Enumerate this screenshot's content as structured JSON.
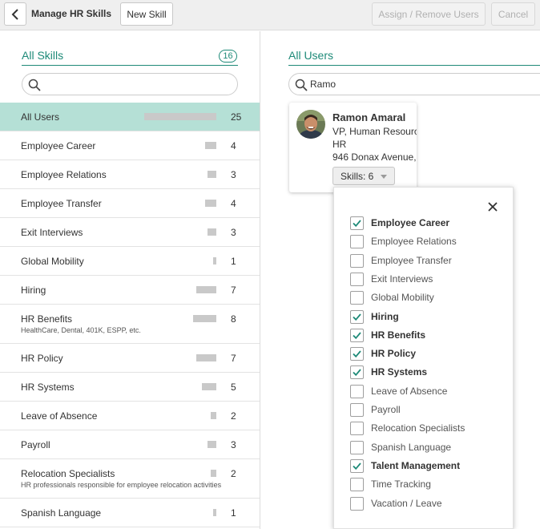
{
  "header": {
    "title": "Manage HR Skills",
    "new_skill_label": "New Skill",
    "assign_label": "Assign / Remove Users",
    "cancel_label": "Cancel"
  },
  "left": {
    "title": "All Skills",
    "count": "16",
    "search_value": "",
    "skills": [
      {
        "name": "All Users",
        "sub": "",
        "count": "25",
        "bar": 1.0,
        "selected": true
      },
      {
        "name": "Employee Career",
        "sub": "",
        "count": "4",
        "bar": 0.16
      },
      {
        "name": "Employee Relations",
        "sub": "",
        "count": "3",
        "bar": 0.12
      },
      {
        "name": "Employee Transfer",
        "sub": "",
        "count": "4",
        "bar": 0.16
      },
      {
        "name": "Exit Interviews",
        "sub": "",
        "count": "3",
        "bar": 0.12
      },
      {
        "name": "Global Mobility",
        "sub": "",
        "count": "1",
        "bar": 0.04
      },
      {
        "name": "Hiring",
        "sub": "",
        "count": "7",
        "bar": 0.28
      },
      {
        "name": "HR Benefits",
        "sub": "HealthCare, Dental, 401K, ESPP, etc.",
        "count": "8",
        "bar": 0.32
      },
      {
        "name": "HR Policy",
        "sub": "",
        "count": "7",
        "bar": 0.28
      },
      {
        "name": "HR Systems",
        "sub": "",
        "count": "5",
        "bar": 0.2
      },
      {
        "name": "Leave of Absence",
        "sub": "",
        "count": "2",
        "bar": 0.08
      },
      {
        "name": "Payroll",
        "sub": "",
        "count": "3",
        "bar": 0.12
      },
      {
        "name": "Relocation Specialists",
        "sub": "HR professionals responsible for employee relocation activities",
        "count": "2",
        "bar": 0.08
      },
      {
        "name": "Spanish Language",
        "sub": "",
        "count": "1",
        "bar": 0.04
      }
    ]
  },
  "right": {
    "title": "All Users",
    "search_value": "Ramo",
    "user": {
      "name": "Ramon Amaral",
      "title": "VP, Human Resources",
      "department": "HR",
      "address": "946 Donax Avenue,",
      "skills_label": "Skills: 6"
    },
    "skill_checks": [
      {
        "label": "Employee Career",
        "checked": true
      },
      {
        "label": "Employee Relations",
        "checked": false
      },
      {
        "label": "Employee Transfer",
        "checked": false
      },
      {
        "label": "Exit Interviews",
        "checked": false
      },
      {
        "label": "Global Mobility",
        "checked": false
      },
      {
        "label": "Hiring",
        "checked": true
      },
      {
        "label": "HR Benefits",
        "checked": true
      },
      {
        "label": "HR Policy",
        "checked": true
      },
      {
        "label": "HR Systems",
        "checked": true
      },
      {
        "label": "Leave of Absence",
        "checked": false
      },
      {
        "label": "Payroll",
        "checked": false
      },
      {
        "label": "Relocation Specialists",
        "checked": false
      },
      {
        "label": "Spanish Language",
        "checked": false
      },
      {
        "label": "Talent Management",
        "checked": true
      },
      {
        "label": "Time Tracking",
        "checked": false
      },
      {
        "label": "Vacation / Leave",
        "checked": false
      }
    ]
  },
  "colors": {
    "accent": "#1e8a78",
    "selected_row": "#b5e0d6",
    "bar": "#c9c9c9"
  }
}
